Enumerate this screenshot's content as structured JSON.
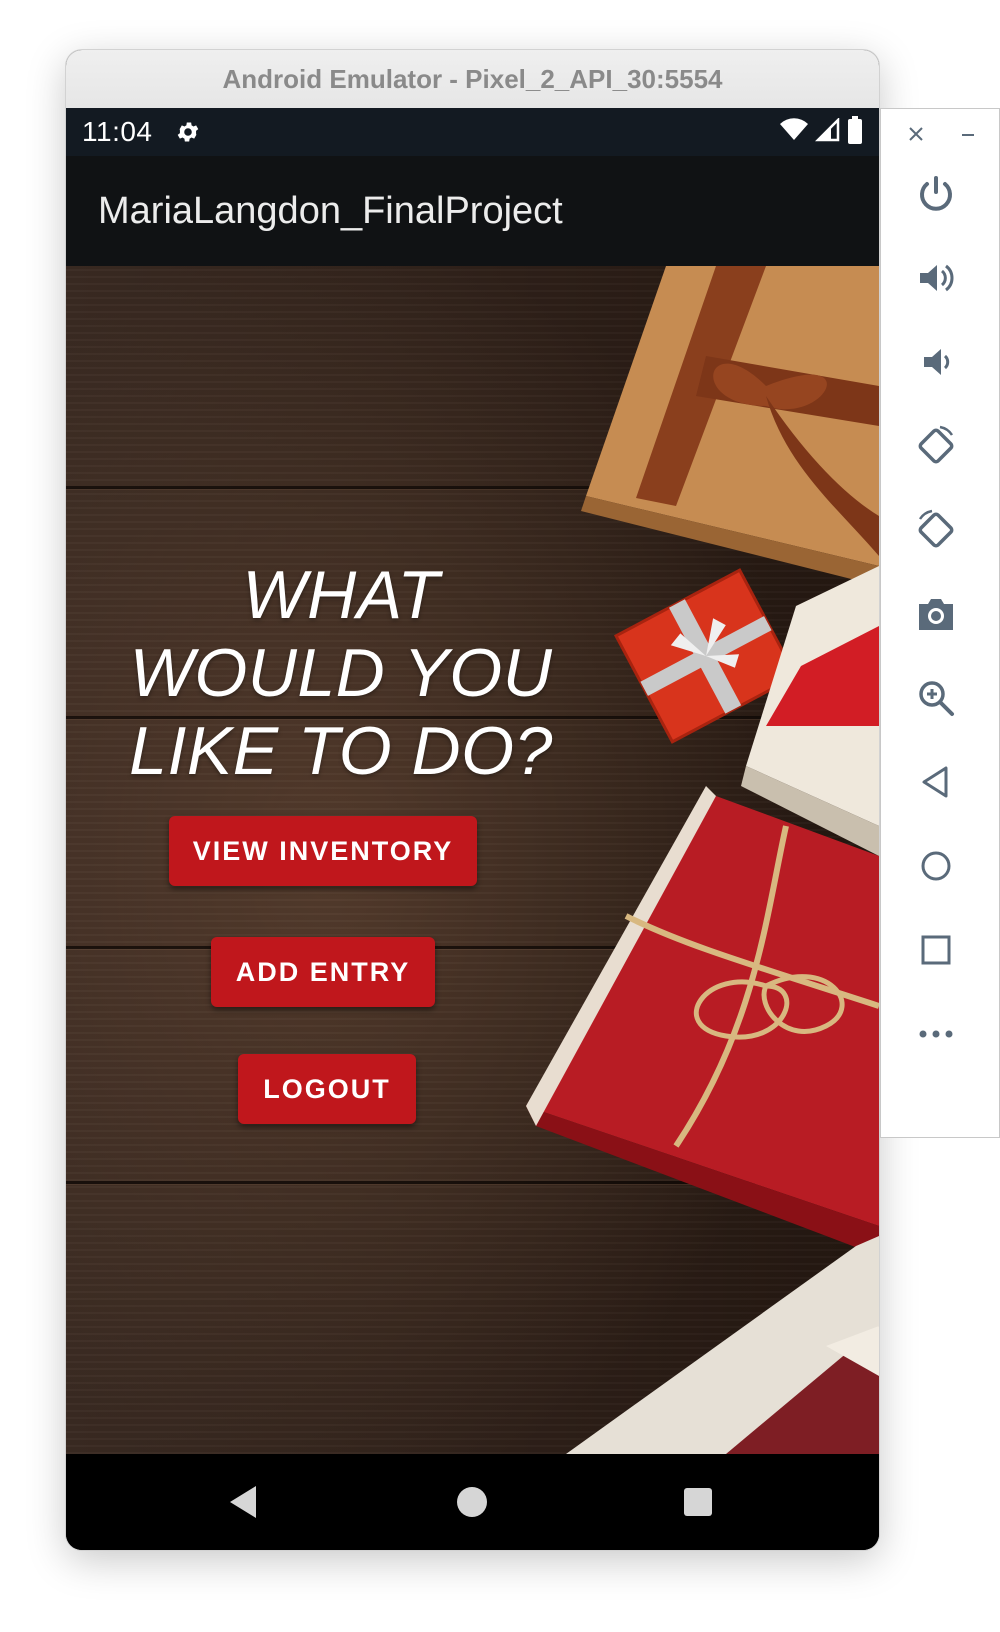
{
  "window": {
    "title": "Android Emulator - Pixel_2_API_30:5554"
  },
  "status_bar": {
    "time": "11:04"
  },
  "app_bar": {
    "title": "MariaLangdon_FinalProject"
  },
  "main": {
    "heading": "WHAT WOULD YOU LIKE TO DO?",
    "buttons": [
      {
        "label": "VIEW INVENTORY"
      },
      {
        "label": "ADD ENTRY"
      },
      {
        "label": "LOGOUT"
      }
    ]
  },
  "colors": {
    "button_red": "#c0171c",
    "app_bar": "#101214",
    "status_bar": "#131a22",
    "toolbar_icons": "#5a6a7a"
  },
  "nav_bar": {
    "icons": [
      "back-icon",
      "home-icon",
      "recents-icon"
    ]
  },
  "side_toolbar": {
    "icons": [
      "close-icon",
      "minimize-icon",
      "power-icon",
      "volume-up-icon",
      "volume-down-icon",
      "rotate-left-icon",
      "rotate-right-icon",
      "camera-icon",
      "zoom-icon",
      "back-icon",
      "home-icon",
      "overview-icon",
      "more-icon"
    ]
  }
}
